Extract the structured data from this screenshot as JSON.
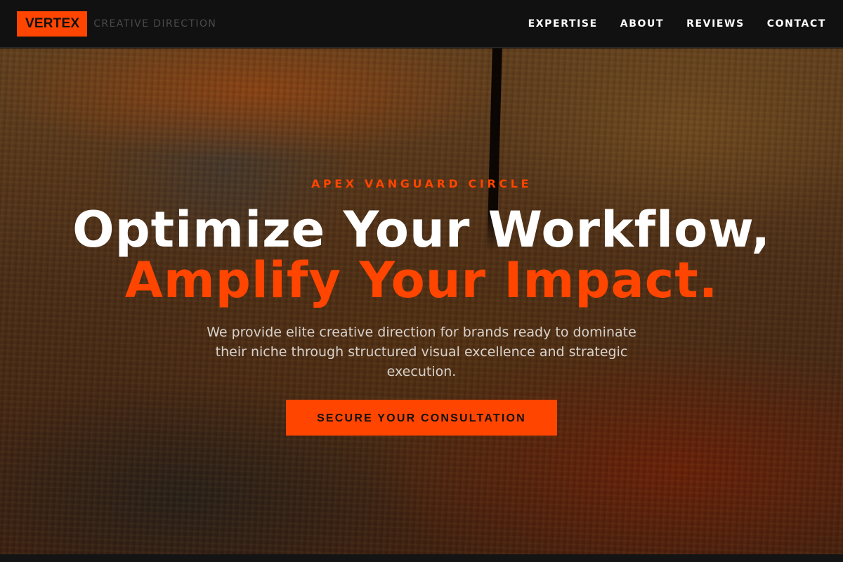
{
  "header": {
    "logo": "VERTEX",
    "tagline": "CREATIVE DIRECTION",
    "nav": [
      "EXPERTISE",
      "ABOUT",
      "REVIEWS",
      "CONTACT"
    ]
  },
  "hero": {
    "eyebrow": "APEX VANGUARD CIRCLE",
    "headline_line1": "Optimize Your Workflow,",
    "headline_line2": "Amplify Your Impact.",
    "subtext": "We provide elite creative direction for brands ready to dominate their niche through structured visual excellence and strategic execution.",
    "cta_label": "SECURE YOUR CONSULTATION"
  },
  "colors": {
    "accent": "#ff4500",
    "background": "#111111",
    "text_primary": "#ffffff",
    "text_muted": "#d8d2cc"
  }
}
